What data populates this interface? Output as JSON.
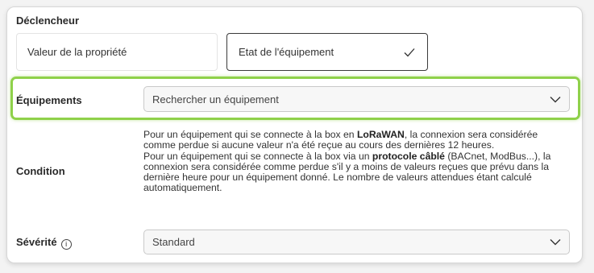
{
  "trigger": {
    "title": "Déclencheur",
    "options": [
      {
        "label": "Valeur de la propriété",
        "selected": false
      },
      {
        "label": "Etat de l'équipement",
        "selected": true
      }
    ]
  },
  "equipments": {
    "label": "Équipements",
    "placeholder": "Rechercher un équipement",
    "highlight_color": "#8fd14a"
  },
  "condition": {
    "label": "Condition",
    "p1_pre": "Pour un équipement qui se connecte à la box en ",
    "p1_bold": "LoRaWAN",
    "p1_post": ", la connexion sera considérée comme perdue si aucune valeur n'a été reçue au cours des dernières 12 heures.",
    "p2_pre": "Pour un équipement qui se connecte à la box via un ",
    "p2_bold": "protocole câblé",
    "p2_post": " (BACnet, ModBus...), la connexion sera considérée comme perdue s'il y a moins de valeurs reçues que prévu dans la dernière heure pour un équipement donné. Le nombre de valeurs attendues étant calculé automatiquement."
  },
  "severity": {
    "label": "Sévérité",
    "info_glyph": "i",
    "value": "Standard"
  }
}
